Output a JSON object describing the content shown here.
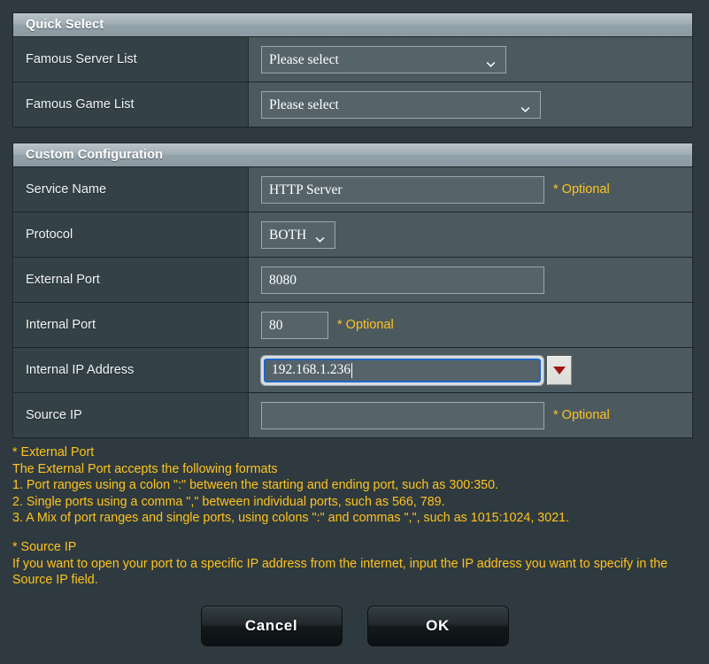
{
  "quick_select": {
    "title": "Quick Select",
    "rows": [
      {
        "label": "Famous Server List",
        "value": "Please select",
        "icon": "chevron-down-icon"
      },
      {
        "label": "Famous Game List",
        "value": "Please select",
        "icon": "chevron-down-icon"
      }
    ]
  },
  "custom_configuration": {
    "title": "Custom Configuration",
    "rows": [
      {
        "label": "Service Name",
        "value": "HTTP Server",
        "optional": "* Optional"
      },
      {
        "label": "Protocol",
        "value": "BOTH",
        "icon": "chevron-down-icon"
      },
      {
        "label": "External Port",
        "value": "8080"
      },
      {
        "label": "Internal Port",
        "value": "80",
        "optional": "* Optional"
      },
      {
        "label": "Internal IP Address",
        "value": "192.168.1.236",
        "icon": "dropdown-triangle-icon"
      },
      {
        "label": "Source IP",
        "value": "",
        "optional": "* Optional"
      }
    ]
  },
  "notes": {
    "external_port_heading": "* External Port",
    "external_port_intro": "The External Port accepts the following formats",
    "external_port_items": [
      "1. Port ranges using a colon \":\" between the starting and ending port, such as 300:350.",
      "2. Single ports using a comma \",\" between individual ports, such as 566, 789.",
      "3. A Mix of port ranges and single ports, using colons \":\" and commas \",\", such as 1015:1024, 3021."
    ],
    "source_ip_heading": "* Source IP",
    "source_ip_body": "If you want to open your port to a specific IP address from the internet, input the IP address you want to specify in the Source IP field."
  },
  "footer": {
    "cancel_label": "Cancel",
    "ok_label": "OK"
  },
  "colors": {
    "background": "#2e3a3f",
    "panel_header_light": "#b9c3c8",
    "label_column": "#344247",
    "value_column": "#4c5a60",
    "note_yellow": "#ffc31f",
    "focus_blue": "#1f66c9",
    "dropdown_red": "#9e1414"
  }
}
